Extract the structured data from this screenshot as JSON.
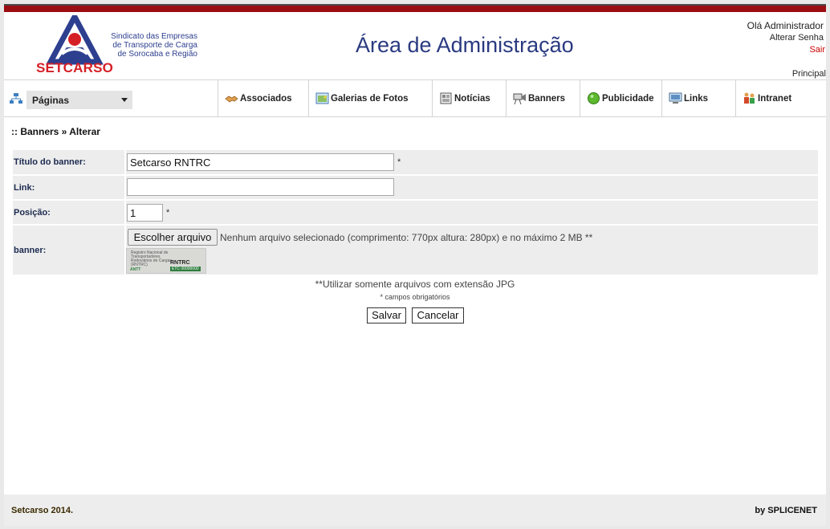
{
  "header": {
    "logo_text": "SETCARSO",
    "org_name_lines": [
      "Sindicato das Empresas",
      "de Transporte de Carga",
      "de Sorocaba e Região"
    ],
    "title": "Área de Administração",
    "greeting": "Olá Administrador",
    "change_password": "Alterar Senha",
    "logout": "Sair",
    "home": "Principal"
  },
  "nav": {
    "pages_select": "Páginas",
    "items": [
      {
        "label": "Associados",
        "icon": "handshake-icon"
      },
      {
        "label": "Galerias de Fotos",
        "icon": "photo-gallery-icon"
      },
      {
        "label": "Notícias",
        "icon": "news-icon"
      },
      {
        "label": "Banners",
        "icon": "projector-icon"
      },
      {
        "label": "Publicidade",
        "icon": "green-circle-icon"
      },
      {
        "label": "Links",
        "icon": "computer-icon"
      },
      {
        "label": "Intranet",
        "icon": "users-icon"
      }
    ]
  },
  "breadcrumb": ":: Banners » Alterar",
  "form": {
    "title_label": "Título do banner:",
    "title_value": "Setcarso RNTRC",
    "link_label": "Link:",
    "link_value": "",
    "position_label": "Posição:",
    "position_value": "1",
    "banner_label": "banner:",
    "file_button": "Escolher arquivo",
    "file_status": "Nenhum arquivo selecionado",
    "file_hint": "(comprimento: 770px altura: 280px) e no máximo 2 MB **",
    "required_mark": "*",
    "thumb": {
      "line1": "Registro Nacional de Transportadores",
      "line2": "Rodoviários de Cargas (RNTRC)",
      "rntrc": "RNTRC",
      "etc": "ETC 00000000",
      "agency": "ANTT"
    }
  },
  "notes": {
    "jpg_only": "**Utilizar somente arquivos com extensão JPG",
    "required_fields": "* campos obrigatórios"
  },
  "buttons": {
    "save": "Salvar",
    "cancel": "Cancelar"
  },
  "footer": {
    "left": "Setcarso 2014.",
    "right": "by SPLICENET"
  },
  "colors": {
    "top_bar": "#9a0d12",
    "title_blue": "#2a3a80",
    "logo_red": "#d51f26",
    "form_row_bg": "#ededed"
  }
}
